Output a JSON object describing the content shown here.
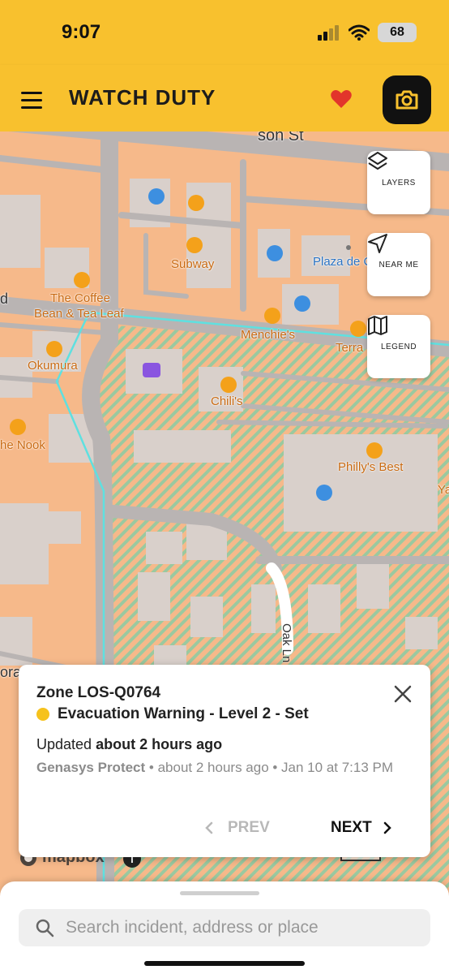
{
  "status_bar": {
    "time": "9:07",
    "battery": "68"
  },
  "header": {
    "title": "WATCH DUTY"
  },
  "map_controls": {
    "layers_label": "LAYERS",
    "near_me_label": "NEAR ME",
    "legend_label": "LEGEND"
  },
  "map_labels": {
    "street_top": "son St",
    "subway": "Subway",
    "plaza": "Plaza de C",
    "coffee_line1": "The Coffee",
    "coffee_line2": "Bean & Tea Leaf",
    "menchies": "Menchie's",
    "terra": "Terra",
    "okumura": "Okumura",
    "chilis": "Chili's",
    "the_nook": "he Nook",
    "phillys": "Philly's Best",
    "ya": "Ya",
    "oak": "Oak Ln",
    "left_road": "d",
    "left_ora": "ora"
  },
  "popup": {
    "zone": "Zone LOS-Q0764",
    "status": "Evacuation Warning - Level 2 - Set",
    "updated_prefix": "Updated",
    "updated_time": "about 2 hours ago",
    "source": "Genasys Protect",
    "source_detail": "• about 2 hours ago • Jan 10 at 7:13 PM",
    "prev_label": "PREV",
    "next_label": "NEXT",
    "status_color": "#f6c21c"
  },
  "map_attribution": {
    "mapbox": "mapbox",
    "info": "i",
    "scale": "200 ft"
  },
  "search": {
    "placeholder": "Search incident, address or place"
  },
  "colors": {
    "brand": "#f8c12e",
    "map_base": "#f6b98a",
    "zone_hatch": "#9ac9a0",
    "boundary": "#5fe0e0"
  }
}
